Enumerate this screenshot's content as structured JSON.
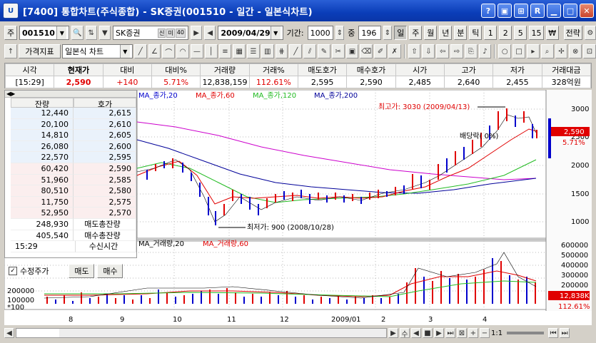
{
  "window": {
    "app_icon": "U",
    "title": "[7400] 통합차트(주식종합) - SK증권(001510 - 일간 - 일본식차트)",
    "buttons": [
      "?",
      "▣",
      "⊞",
      "R",
      "▁",
      "□",
      "✕"
    ]
  },
  "toolbar1": {
    "prefix": "주",
    "code": "001510",
    "stock_name": "SK증권",
    "name_btns": [
      "신",
      "미",
      "40"
    ],
    "date": "2009/04/29",
    "period_label": "기간:",
    "period_value": "1000",
    "center_label": "중",
    "center_value": "196",
    "tabs": [
      "일",
      "주",
      "월",
      "년",
      "분",
      "틱",
      "1",
      "2",
      "5",
      "15",
      "₩"
    ],
    "strategy": "전략"
  },
  "toolbar2": {
    "price_indicator": "가격지표",
    "chart_type": "일본식 차트"
  },
  "quote": {
    "headers": [
      "시각",
      "현재가",
      "대비",
      "대비%",
      "거래량",
      "거래%",
      "매도호가",
      "매수호가",
      "시가",
      "고가",
      "저가",
      "거래대금"
    ],
    "values": [
      "[15:29]",
      "2,590",
      "+140",
      "5.71%",
      "12,838,159",
      "112.61%",
      "2,595",
      "2,590",
      "2,485",
      "2,640",
      "2,455",
      "328억원"
    ]
  },
  "orderbook": {
    "col_qty": "잔량",
    "col_price": "호가",
    "sell": [
      {
        "qty": "12,440",
        "price": "2,615"
      },
      {
        "qty": "20,100",
        "price": "2,610"
      },
      {
        "qty": "14,810",
        "price": "2,605"
      },
      {
        "qty": "26,080",
        "price": "2,600"
      },
      {
        "qty": "22,570",
        "price": "2,595"
      }
    ],
    "buy": [
      {
        "qty": "60,420",
        "price": "2,590"
      },
      {
        "qty": "51,960",
        "price": "2,585"
      },
      {
        "qty": "80,510",
        "price": "2,580"
      },
      {
        "qty": "11,750",
        "price": "2,575"
      },
      {
        "qty": "52,950",
        "price": "2,570"
      }
    ],
    "sell_total": "248,930",
    "sell_total_label": "매도총잔량",
    "buy_total": "405,540",
    "buy_total_label": "매수총잔량",
    "time": "15:29",
    "time_label": "수신시간",
    "adjusted_label": "수정주가",
    "sell_btn": "매도",
    "buy_btn": "매수"
  },
  "chart_data": {
    "type": "line",
    "price_legend": [
      "MA_종가,20",
      "MA_종가,60",
      "MA_종가,120",
      "MA_종가,200"
    ],
    "volume_legend": [
      "MA_거래량,20",
      "MA_거래량,60"
    ],
    "price_ticks": [
      3000,
      2500,
      2000,
      1500,
      1000
    ],
    "volume_ticks": [
      "600000",
      "500000",
      "400000",
      "300000",
      "200000",
      "100000"
    ],
    "volume_left_ticks": [
      "200000",
      "100000"
    ],
    "volume_unit": "*100",
    "x_labels": [
      "8",
      "9",
      "10",
      "11",
      "12",
      "2009/01",
      "2",
      "3",
      "4"
    ],
    "annotation_high": "최고가: 3030 (2009/04/13)",
    "annotation_low": "최저가: 900 (2008/10/28)",
    "annotation_div": "배당락( 0%)",
    "current_price": "2,590",
    "current_pct": "5.71%",
    "current_volume": "12,838K",
    "current_volume_pct": "112.61%",
    "colors": {
      "ma20": "#e00000",
      "ma60": "#22bb22",
      "ma120": "#cc00cc",
      "ma200": "#000099",
      "up": "#e00000",
      "down": "#0000cc"
    }
  },
  "scrollbar": {
    "zoom_label": "1:1"
  }
}
